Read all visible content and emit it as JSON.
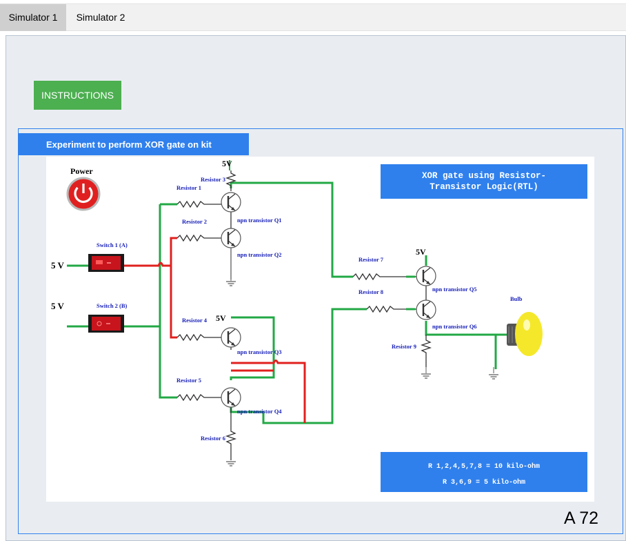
{
  "tabs": [
    {
      "label": "Simulator 1",
      "active": true
    },
    {
      "label": "Simulator 2",
      "active": false
    }
  ],
  "instructions_label": "INSTRUCTIONS",
  "experiment_title": "Experiment to perform XOR gate on kit",
  "circuit": {
    "power_label": "Power",
    "v5_a": "5 V",
    "v5_b": "5 V",
    "switch1": "Switch 1 (A)",
    "switch2": "Switch 2 (B)",
    "supply1": "5V",
    "supply2": "5V",
    "supply3": "5V",
    "resistor1": "Resistor 1",
    "resistor2": "Resistor 2",
    "resistor3": "Resistor 3",
    "resistor4": "Resistor 4",
    "resistor5": "Resistor 5",
    "resistor6": "Resistor 6",
    "resistor7": "Resistor 7",
    "resistor8": "Resistor 8",
    "resistor9": "Resistor 9",
    "q1": "npn transistor Q1",
    "q2": "npn transistor Q2",
    "q3": "npn transistor Q3",
    "q4": "npn transistor Q4",
    "q5": "npn transistor Q5",
    "q6": "npn transistor Q6",
    "bulb": "Bulb"
  },
  "info_title_line1": "XOR gate using Resistor-",
  "info_title_line2": "Transistor Logic(RTL)",
  "resistance_line1": "R 1,2,4,5,7,8 = 10 kilo-ohm",
  "resistance_line2": "R 3,6,9 = 5 kilo-ohm",
  "counter": "A 72",
  "colors": {
    "wire_on": "#e0201e",
    "wire_off": "#22a845",
    "accent": "#2f80ed",
    "button": "#4caf50"
  }
}
